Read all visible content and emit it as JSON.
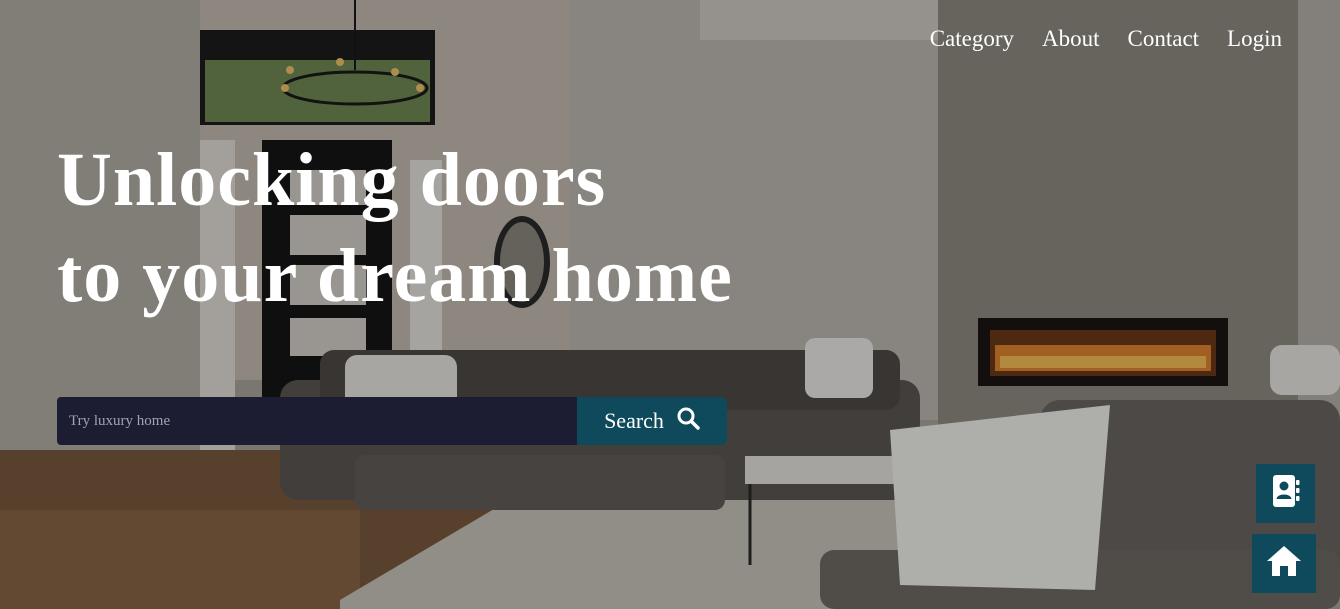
{
  "nav": {
    "items": [
      {
        "label": "Category"
      },
      {
        "label": "About"
      },
      {
        "label": "Contact"
      },
      {
        "label": "Login"
      }
    ]
  },
  "hero": {
    "headline_line1": "Unlocking doors",
    "headline_line2": "to your dream home",
    "background_image": "luxury living room interior with sofas, fireplace and chandelier"
  },
  "search": {
    "placeholder": "Try luxury home",
    "value": "",
    "button_label": "Search",
    "button_icon": "search-icon"
  },
  "floating_buttons": [
    {
      "icon": "contact-book-icon"
    },
    {
      "icon": "home-icon"
    }
  ],
  "colors": {
    "accent": "#0e4a5b",
    "input_background": "#1c1c33",
    "text": "#ffffff"
  }
}
